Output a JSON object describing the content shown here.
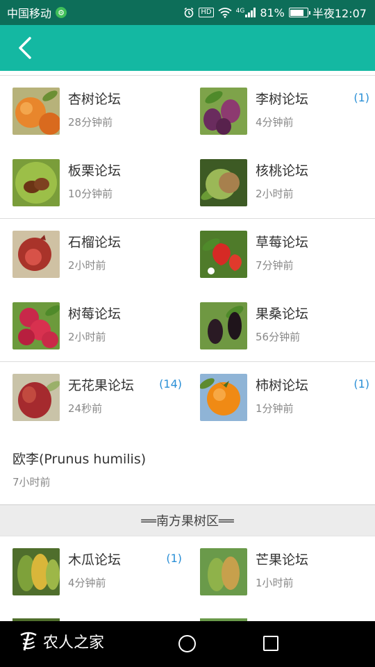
{
  "status_bar": {
    "carrier": "中国移动",
    "carrier_badge": "⚙",
    "network": "4G",
    "battery_percent": "81%",
    "battery_level": 0.81,
    "time": "半夜12:07",
    "hd_label": "HD"
  },
  "sections": [
    {
      "rows": [
        [
          {
            "name": "杏树论坛",
            "time": "28分钟前",
            "badge": "",
            "fruit": "apricot"
          },
          {
            "name": "李树论坛",
            "time": "4分钟前",
            "badge": "(1)",
            "fruit": "plum"
          }
        ],
        [
          {
            "name": "板栗论坛",
            "time": "10分钟前",
            "badge": "",
            "fruit": "chestnut"
          },
          {
            "name": "核桃论坛",
            "time": "2小时前",
            "badge": "",
            "fruit": "walnut"
          }
        ]
      ]
    },
    {
      "rows": [
        [
          {
            "name": "石榴论坛",
            "time": "2小时前",
            "badge": "",
            "fruit": "pomegranate"
          },
          {
            "name": "草莓论坛",
            "time": "7分钟前",
            "badge": "",
            "fruit": "strawberry"
          }
        ],
        [
          {
            "name": "树莓论坛",
            "time": "2小时前",
            "badge": "",
            "fruit": "raspberry"
          },
          {
            "name": "果桑论坛",
            "time": "56分钟前",
            "badge": "",
            "fruit": "mulberry"
          }
        ]
      ]
    },
    {
      "rows": [
        [
          {
            "name": "无花果论坛",
            "time": "24秒前",
            "badge": "(14)",
            "fruit": "fig"
          },
          {
            "name": "柿树论坛",
            "time": "1分钟前",
            "badge": "(1)",
            "fruit": "persimmon"
          }
        ]
      ],
      "wide_item": {
        "name": "欧李(Prunus humilis)",
        "time": "7小时前"
      }
    }
  ],
  "southern_header": "══南方果树区══",
  "southern_rows": [
    [
      {
        "name": "木瓜论坛",
        "time": "4分钟前",
        "badge": "(1)",
        "fruit": "papaya"
      },
      {
        "name": "芒果论坛",
        "time": "1小时前",
        "badge": "",
        "fruit": "mango"
      }
    ]
  ],
  "nav_bar": {
    "brand": "农人之家"
  },
  "colors": {
    "status_bar": "#0d6e59",
    "app_bar": "#14b8a2",
    "badge": "#2a8fd6"
  }
}
